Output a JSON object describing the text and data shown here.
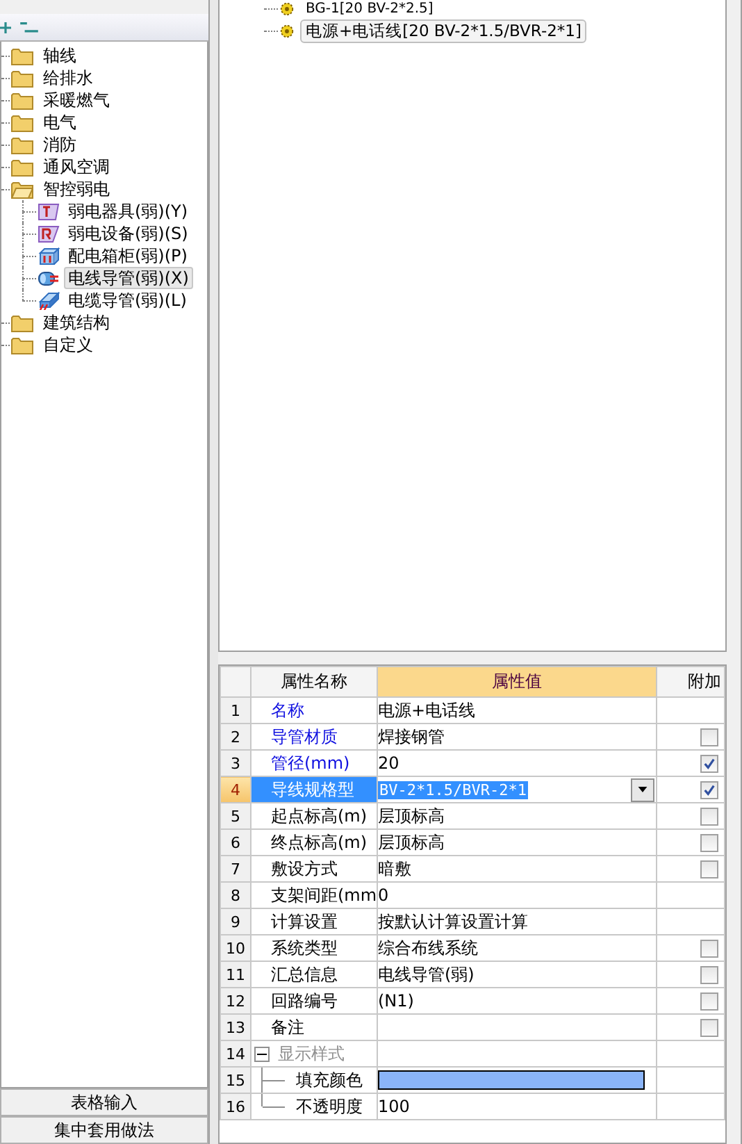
{
  "left_toolbar": {
    "buttons": [
      {
        "kind": "expand"
      },
      {
        "kind": "collapse"
      }
    ]
  },
  "category_tree": [
    {
      "label": "轴线",
      "expanded": false,
      "selected": false
    },
    {
      "label": "给排水",
      "expanded": false,
      "selected": false
    },
    {
      "label": "采暖燃气",
      "expanded": false,
      "selected": false
    },
    {
      "label": "电气",
      "expanded": false,
      "selected": false
    },
    {
      "label": "消防",
      "expanded": false,
      "selected": false
    },
    {
      "label": "通风空调",
      "expanded": false,
      "selected": false
    },
    {
      "label": "智控弱电",
      "expanded": true,
      "selected": false,
      "children": [
        {
          "label": "弱电器具(弱)(Y)",
          "kind": "device",
          "selected": false
        },
        {
          "label": "弱电设备(弱)(S)",
          "kind": "equipment",
          "selected": false
        },
        {
          "label": "配电箱柜(弱)(P)",
          "kind": "cabinet",
          "selected": false
        },
        {
          "label": "电线导管(弱)(X)",
          "kind": "conduit",
          "selected": true
        },
        {
          "label": "电缆导管(弱)(L)",
          "kind": "cable",
          "selected": false
        }
      ]
    },
    {
      "label": "建筑结构",
      "expanded": false,
      "selected": false
    },
    {
      "label": "自定义",
      "expanded": false,
      "selected": false
    }
  ],
  "bottom_buttons": [
    "表格输入",
    "集中套用做法"
  ],
  "component_tree": [
    {
      "label": "BG-1[20 BV-2*2.5]",
      "selected": false
    },
    {
      "label": "电源+电话线[20 BV-2*1.5/BVR-2*1]",
      "selected": true
    }
  ],
  "property_grid": {
    "columns": [
      "属性名称",
      "属性值",
      "附加"
    ],
    "rows": [
      {
        "num": "1",
        "name": "名称",
        "kind": "text",
        "value": "电源+电话线",
        "emphasized": true,
        "selected": false
      },
      {
        "num": "2",
        "name": "导管材质",
        "kind": "text",
        "value": "焊接钢管",
        "emphasized": true,
        "selected": false,
        "checked": false
      },
      {
        "num": "3",
        "name": "管径(mm)",
        "kind": "text",
        "value": "20",
        "emphasized": true,
        "selected": false,
        "checked": true
      },
      {
        "num": "4",
        "name": "导线规格型",
        "kind": "dropdown",
        "value": "BV-2*1.5/BVR-2*1",
        "emphasized": false,
        "selected": true,
        "checked": true
      },
      {
        "num": "5",
        "name": "起点标高(m)",
        "kind": "text",
        "value": "层顶标高",
        "emphasized": false,
        "selected": false,
        "checked": false
      },
      {
        "num": "6",
        "name": "终点标高(m)",
        "kind": "text",
        "value": "层顶标高",
        "emphasized": false,
        "selected": false,
        "checked": false
      },
      {
        "num": "7",
        "name": "敷设方式",
        "kind": "text",
        "value": "暗敷",
        "emphasized": false,
        "selected": false,
        "checked": false
      },
      {
        "num": "8",
        "name": "支架间距(mm",
        "kind": "text",
        "value": "0",
        "emphasized": false,
        "selected": false
      },
      {
        "num": "9",
        "name": "计算设置",
        "kind": "text",
        "value": "按默认计算设置计算",
        "emphasized": false,
        "selected": false
      },
      {
        "num": "10",
        "name": "系统类型",
        "kind": "text",
        "value": "综合布线系统",
        "emphasized": false,
        "selected": false,
        "checked": false
      },
      {
        "num": "11",
        "name": "汇总信息",
        "kind": "text",
        "value": "电线导管(弱)",
        "emphasized": false,
        "selected": false,
        "checked": false
      },
      {
        "num": "12",
        "name": "回路编号",
        "kind": "text",
        "value": "(N1)",
        "emphasized": false,
        "selected": false,
        "checked": false
      },
      {
        "num": "13",
        "name": "备注",
        "kind": "text",
        "emphasized": false,
        "selected": false,
        "checked": false
      },
      {
        "num": "14",
        "name": "显示样式",
        "kind": "group",
        "expanded": true,
        "selected": false,
        "children": [
          {
            "num": "15",
            "name": "填充颜色",
            "kind": "color",
            "color": "#8ab4f8",
            "selected": false
          },
          {
            "num": "16",
            "name": "不透明度",
            "kind": "text",
            "value": "100",
            "selected": false
          }
        ]
      }
    ]
  }
}
